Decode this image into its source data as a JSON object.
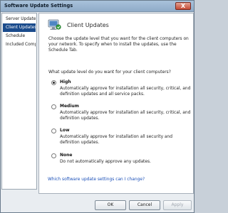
{
  "window": {
    "title": "Software Update Settings",
    "close_label": "X"
  },
  "sidebar": {
    "items": [
      {
        "label": "Server Updates",
        "selected": false
      },
      {
        "label": "Client Updates",
        "selected": true
      },
      {
        "label": "Schedule",
        "selected": false
      },
      {
        "label": "Included Compu...",
        "selected": false
      }
    ]
  },
  "panel": {
    "title": "Client Updates",
    "intro": "Choose the update level that you want for the client computers on your network. To specify when to install the updates, use the Schedule Tab.",
    "question": "What update level do you want for your client computers?",
    "options": [
      {
        "label": "High",
        "description": "Automatically approve for installation all security, critical, and definition updates and all service packs.",
        "selected": true
      },
      {
        "label": "Medium",
        "description": "Automatically approve for installation all security, critical, and definition updates.",
        "selected": false
      },
      {
        "label": "Low",
        "description": "Automatically approve for installation all security and definition updates.",
        "selected": false
      },
      {
        "label": "None",
        "description": "Do not automatically approve any updates.",
        "selected": false
      }
    ],
    "help_link": "Which software update settings can I change?"
  },
  "buttons": {
    "ok": "OK",
    "cancel": "Cancel",
    "apply": "Apply"
  },
  "colors": {
    "selection": "#1a4b8c",
    "link": "#1a4fb8",
    "titlebar": "#9fb8d3"
  },
  "icons": {
    "header": "computer-update-icon",
    "close": "close-icon"
  }
}
